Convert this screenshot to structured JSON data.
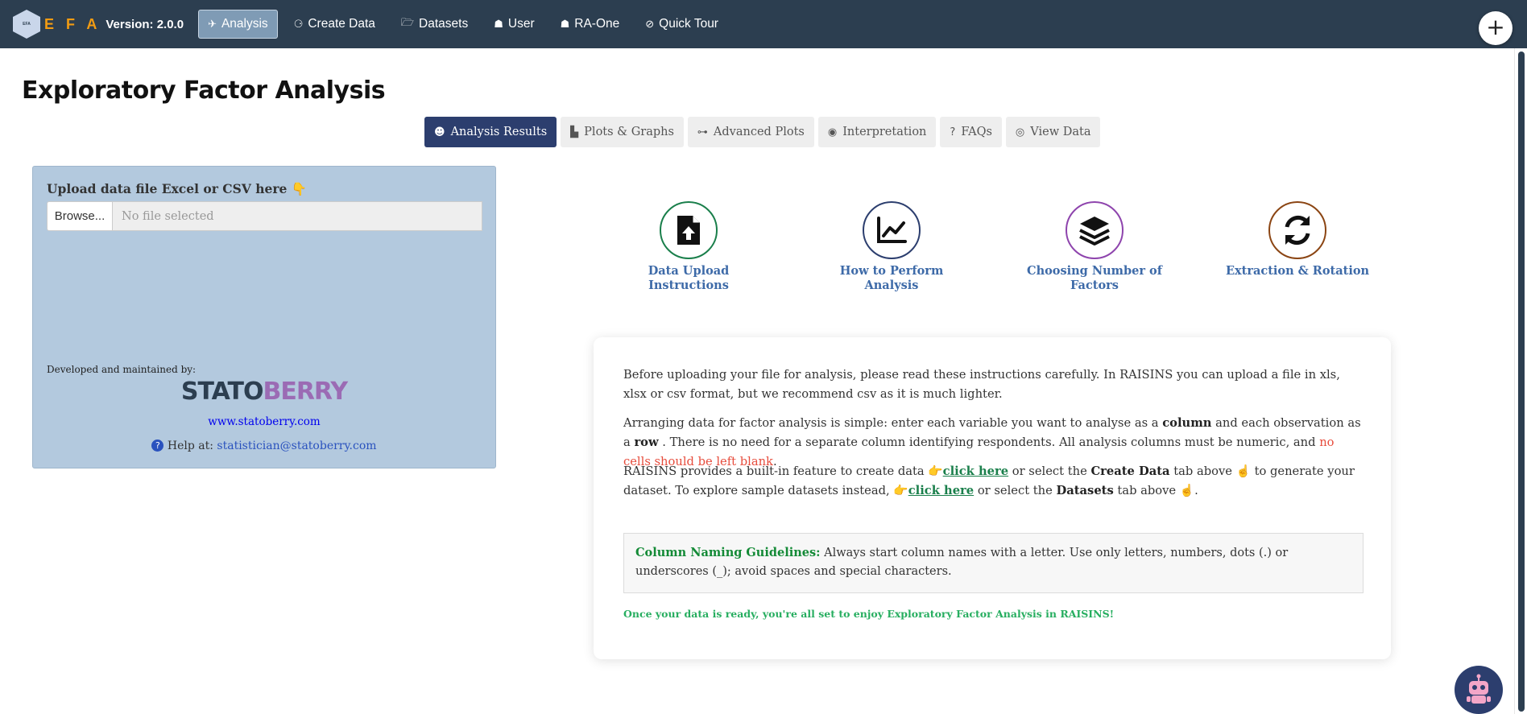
{
  "navbar": {
    "brand": "E F A",
    "version": "Version: 2.0.0",
    "items": [
      {
        "label": "Analysis",
        "icon": "paper-plane-icon",
        "glyph": "✈",
        "active": true
      },
      {
        "label": "Create Data",
        "icon": "binoculars-icon",
        "glyph": "⚆",
        "active": false
      },
      {
        "label": "Datasets",
        "icon": "folder-open-icon",
        "glyph": "🗁",
        "active": false
      },
      {
        "label": "User",
        "icon": "user-icon",
        "glyph": "☗",
        "active": false
      },
      {
        "label": "RA-One",
        "icon": "robot-icon",
        "glyph": "☗",
        "active": false
      },
      {
        "label": "Quick Tour",
        "icon": "compass-icon",
        "glyph": "⊘",
        "active": false
      }
    ],
    "plus_label": "+",
    "bg_color": "#2c3e50",
    "brand_color": "#f39c12"
  },
  "page_title": "Exploratory Factor Analysis",
  "tabs": [
    {
      "label": "Analysis Results",
      "icon": "theater-masks-icon",
      "glyph": "☻",
      "active": true
    },
    {
      "label": "Plots & Graphs",
      "icon": "chart-bar-icon",
      "glyph": "▙",
      "active": false
    },
    {
      "label": "Advanced Plots",
      "icon": "project-diagram-icon",
      "glyph": "⊶",
      "active": false
    },
    {
      "label": "Interpretation",
      "icon": "compass-icon",
      "glyph": "◉",
      "active": false
    },
    {
      "label": "FAQs",
      "icon": "question-icon",
      "glyph": "?",
      "active": false
    },
    {
      "label": "View Data",
      "icon": "eye-icon",
      "glyph": "◎",
      "active": false
    }
  ],
  "sidebar": {
    "upload_label": "Upload data file Excel or CSV here 👇",
    "browse_label": "Browse...",
    "file_placeholder": "No file selected",
    "developed_label": "Developed and maintained by:",
    "logo_text_a": "STATO",
    "logo_text_b": "BERRY",
    "website": "www.statoberry.com",
    "help_label": "Help at:",
    "help_email": "statistician@statoberry.com",
    "bg_color": "#b3c9de"
  },
  "info_cards": [
    {
      "title": "Data Upload Instructions",
      "icon": "file-upload-icon",
      "color": "#1a7f4b"
    },
    {
      "title": "How to Perform Analysis",
      "icon": "line-chart-icon",
      "color": "#2c3e6e"
    },
    {
      "title": "Choosing Number of Factors",
      "icon": "layers-icon",
      "color": "#8e44ad"
    },
    {
      "title": "Extraction & Rotation",
      "icon": "sync-icon",
      "color": "#8b4513"
    }
  ],
  "content": {
    "para1": "Before uploading your file for analysis, please read these instructions carefully. In RAISINS you can upload a file in xls, xlsx or csv format, but we recommend csv as it is much lighter.",
    "para2_a": "Arranging data for factor analysis is simple: enter each variable you want to analyse as a",
    "para2_column": "column",
    "para2_b": "and each observation as a",
    "para2_row": "row",
    "para2_c": ". There is no need for a separate column identifying respondents. All analysis columns must be numeric, and",
    "para2_red": "no cells should be left blank",
    "para2_d": ".",
    "para3_a": "RAISINS provides a built-in feature to create data",
    "para3_link1": "click here",
    "para3_b": "or select the",
    "para3_create": "Create Data",
    "para3_c": "tab above",
    "para3_d": "to generate your dataset. To explore sample datasets instead,",
    "para3_link2": "click here",
    "para3_e": "or select the",
    "para3_datasets": "Datasets",
    "para3_f": "tab above",
    "para3_g": ".",
    "guidelines_title": "Column Naming Guidelines:",
    "guidelines_text": "Always start column names with a letter. Use only letters, numbers, dots (.) or underscores (_); avoid spaces and special characters.",
    "ready_text": "Once your data is ready, you're all set to enjoy Exploratory Factor Analysis in RAISINS!"
  }
}
